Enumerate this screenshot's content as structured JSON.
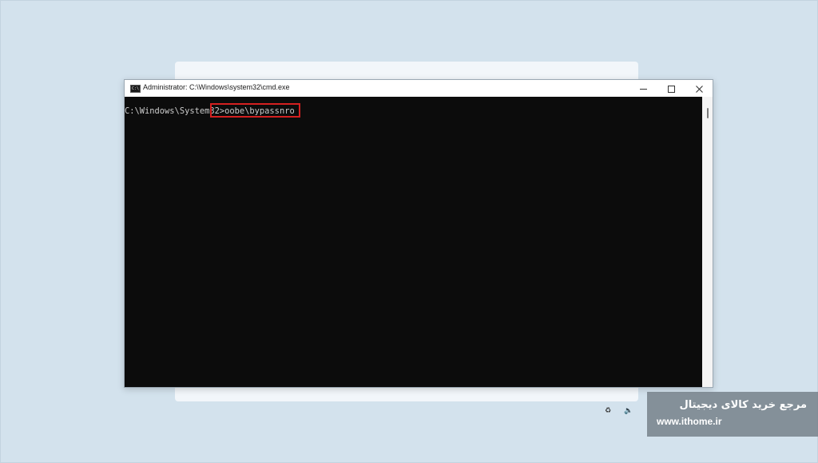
{
  "window": {
    "title": "Administrator: C:\\Windows\\system32\\cmd.exe",
    "icon_label": "C:\\",
    "icon": "cmd-icon"
  },
  "controls": {
    "minimize": "minimize-icon",
    "maximize": "maximize-icon",
    "close": "close-icon"
  },
  "console": {
    "prompt": "C:\\Windows\\System32>",
    "command": "oobe\\bypassnro"
  },
  "tray": {
    "accessibility_icon": "accessibility-icon",
    "volume_icon": "volume-icon"
  },
  "watermark": {
    "persian_text": "مرجع خرید کالای دیجیتال",
    "url": "www.ithome.ir"
  },
  "colors": {
    "background": "#d3e2ed",
    "console_bg": "#0c0c0c",
    "console_text": "#cccccc",
    "highlight": "#d42020",
    "accent": "#2b78c5"
  }
}
